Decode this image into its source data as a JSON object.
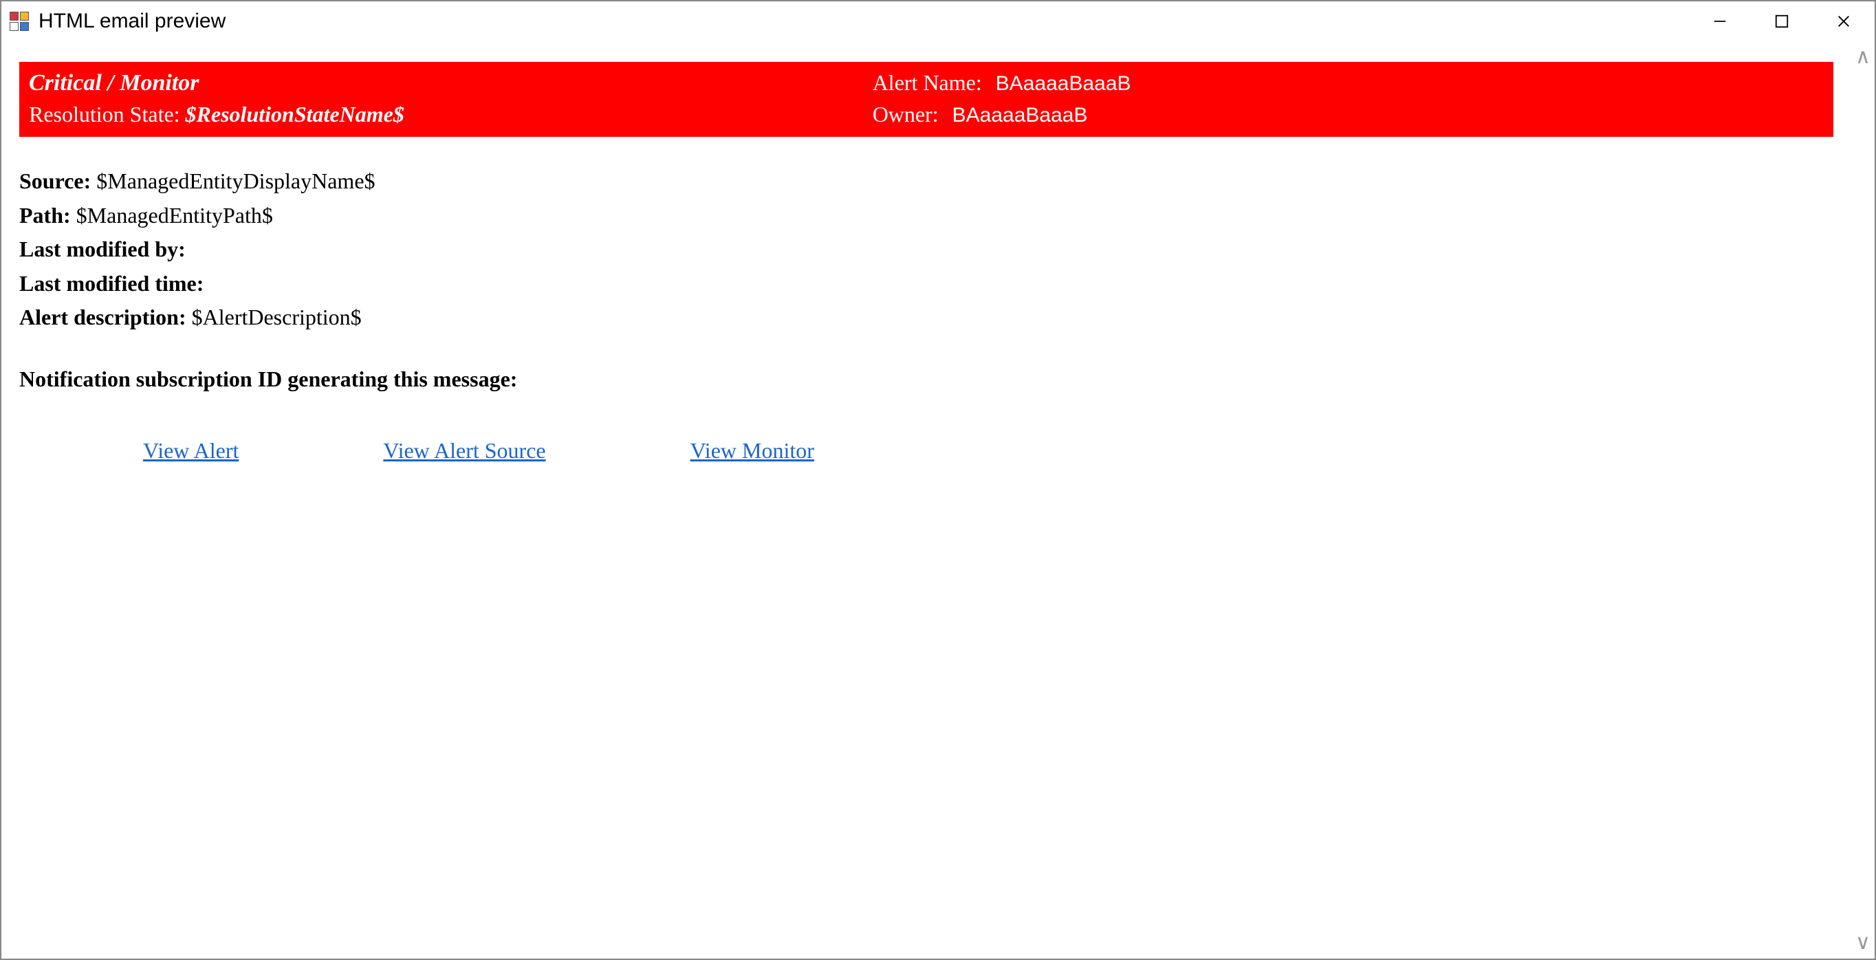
{
  "window": {
    "title": "HTML email preview"
  },
  "banner": {
    "severity": "Critical / Monitor",
    "alert_name_label": "Alert Name:",
    "alert_name_value": "BAaaaaBaaaB",
    "resolution_label": "Resolution State:",
    "resolution_value": "$ResolutionStateName$",
    "owner_label": "Owner:",
    "owner_value": "BAaaaaBaaaB"
  },
  "body": {
    "source_label": "Source:",
    "source_value": "$ManagedEntityDisplayName$",
    "path_label": "Path:",
    "path_value": "$ManagedEntityPath$",
    "lastmodby_label": "Last modified by:",
    "lastmodby_value": "",
    "lastmodtime_label": "Last modified time:",
    "lastmodtime_value": "",
    "alertdesc_label": "Alert description:",
    "alertdesc_value": "$AlertDescription$",
    "subscription_label": "Notification subscription ID generating this message:"
  },
  "links": {
    "view_alert": "View Alert",
    "view_alert_source": "View Alert Source",
    "view_monitor": "View Monitor"
  }
}
